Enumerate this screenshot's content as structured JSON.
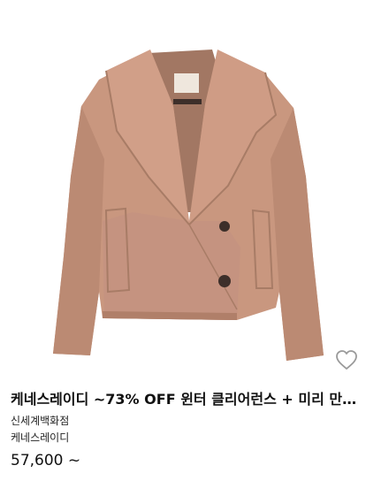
{
  "product": {
    "title": "케네스레이디 ~73% OFF 윈터 클리어런스 + 미리 만나…",
    "store": "신세계백화점",
    "brand": "케네스레이디",
    "price": "57,600 ~",
    "image_icon": "camel-wool-coat-image",
    "wishlist_icon": "heart-outline-icon"
  },
  "colors": {
    "coat": "#c9977f",
    "coat_shadow": "#b07f69",
    "lining": "#a27763",
    "button": "#3d2f2a",
    "heart_stroke": "#9a9a9a",
    "text": "#111111"
  }
}
